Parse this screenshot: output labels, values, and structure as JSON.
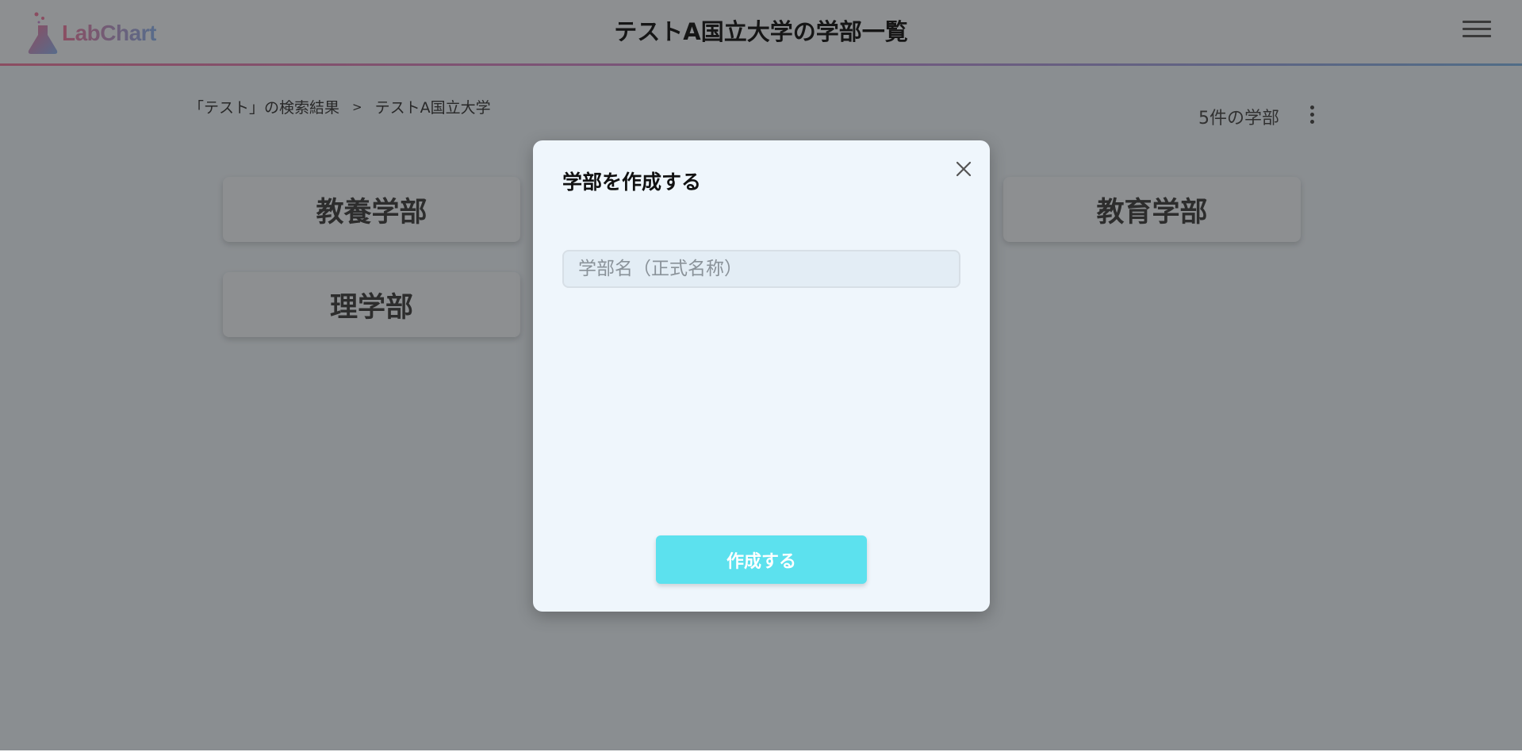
{
  "header": {
    "logo_text": "LabChart",
    "title": "テストA国立大学の学部一覧",
    "menu_icon": "hamburger-menu-icon"
  },
  "breadcrumb": {
    "items": [
      "「テスト」の検索結果",
      "テストA国立大学"
    ],
    "separator": ">"
  },
  "summary": {
    "count_label": "5件の学部",
    "more_icon": "kebab-menu-icon"
  },
  "faculties": [
    {
      "name": "教養学部"
    },
    {
      "name": "教育学部"
    },
    {
      "name": "理学部"
    }
  ],
  "modal": {
    "title": "学部を作成する",
    "close_icon": "close-icon",
    "input": {
      "placeholder": "学部名（正式名称）",
      "value": ""
    },
    "submit_label": "作成する"
  },
  "colors": {
    "accent_button": "#5ce1ee",
    "logo_gradient_start": "#f07aa0",
    "logo_gradient_end": "#8db4ef",
    "modal_background": "#eff6fc"
  }
}
